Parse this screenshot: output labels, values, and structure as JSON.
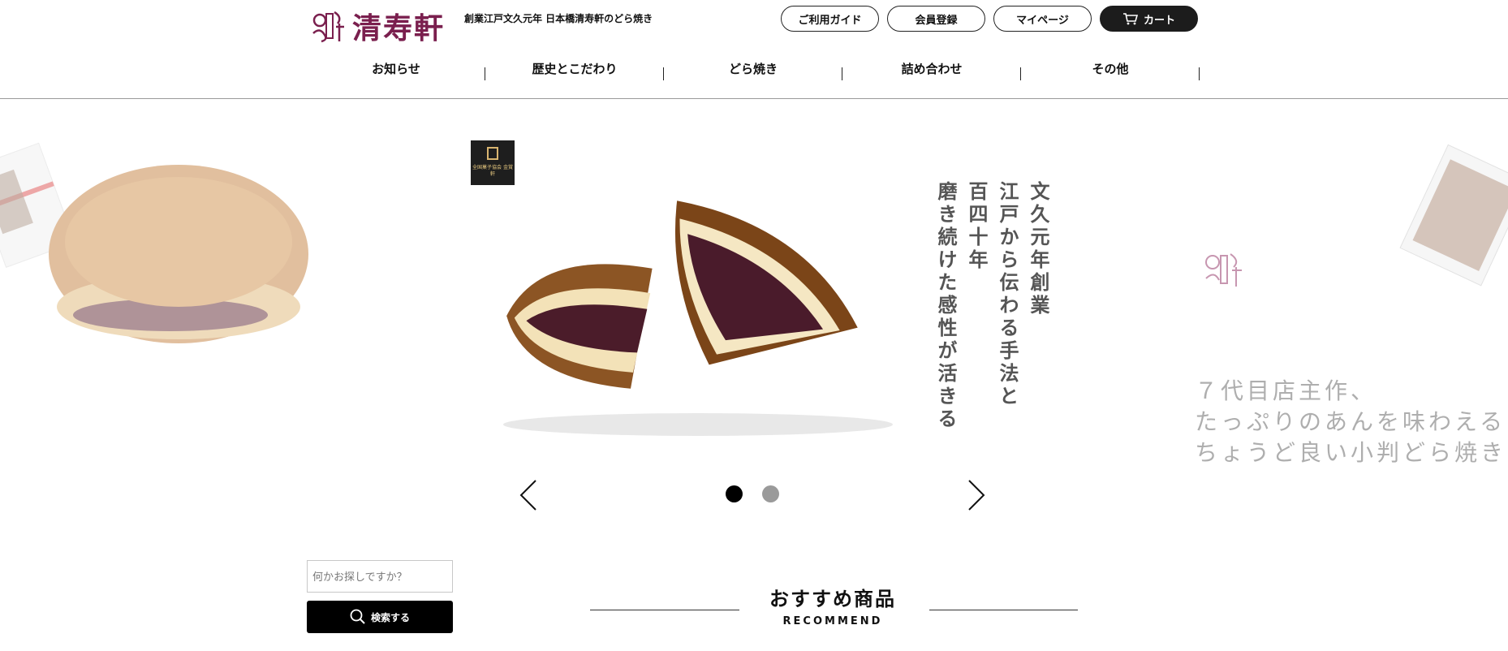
{
  "header": {
    "logo_text": "清寿軒",
    "logo_mark_label": "くり清寿軒",
    "tagline": "創業江戸文久元年 日本橋清寿軒のどら焼き",
    "buttons": {
      "guide": "ご利用ガイド",
      "register": "会員登録",
      "mypage": "マイページ",
      "cart": "カート"
    }
  },
  "nav": {
    "items": [
      "お知らせ",
      "歴史とこだわり",
      "どら焼き",
      "詰め合わせ",
      "その他"
    ]
  },
  "slider": {
    "badge_text": "全国菓子協会 金賞軒",
    "main_text_columns": [
      "文久元年創業",
      "江戸から伝わる手法と",
      "百四十年",
      "磨き続けた感性が活きる"
    ],
    "right_text_lines": [
      "７代目店主作、",
      "たっぷりのあんを味わえる",
      "ちょうど良い小判どら焼き"
    ],
    "dots_count": 2,
    "active_dot": 0
  },
  "search": {
    "placeholder": "何かお探しですか？",
    "button_label": "検索する"
  },
  "recommend": {
    "title": "おすすめ商品",
    "subtitle": "RECOMMEND"
  },
  "colors": {
    "brand": "#7a1f4e",
    "cart_bg": "#1c1c1c",
    "dot_active": "#000000",
    "dot_inactive": "#9a9a9a"
  },
  "icons": [
    "cart-icon",
    "search-icon",
    "chevron-left-icon",
    "chevron-right-icon"
  ]
}
